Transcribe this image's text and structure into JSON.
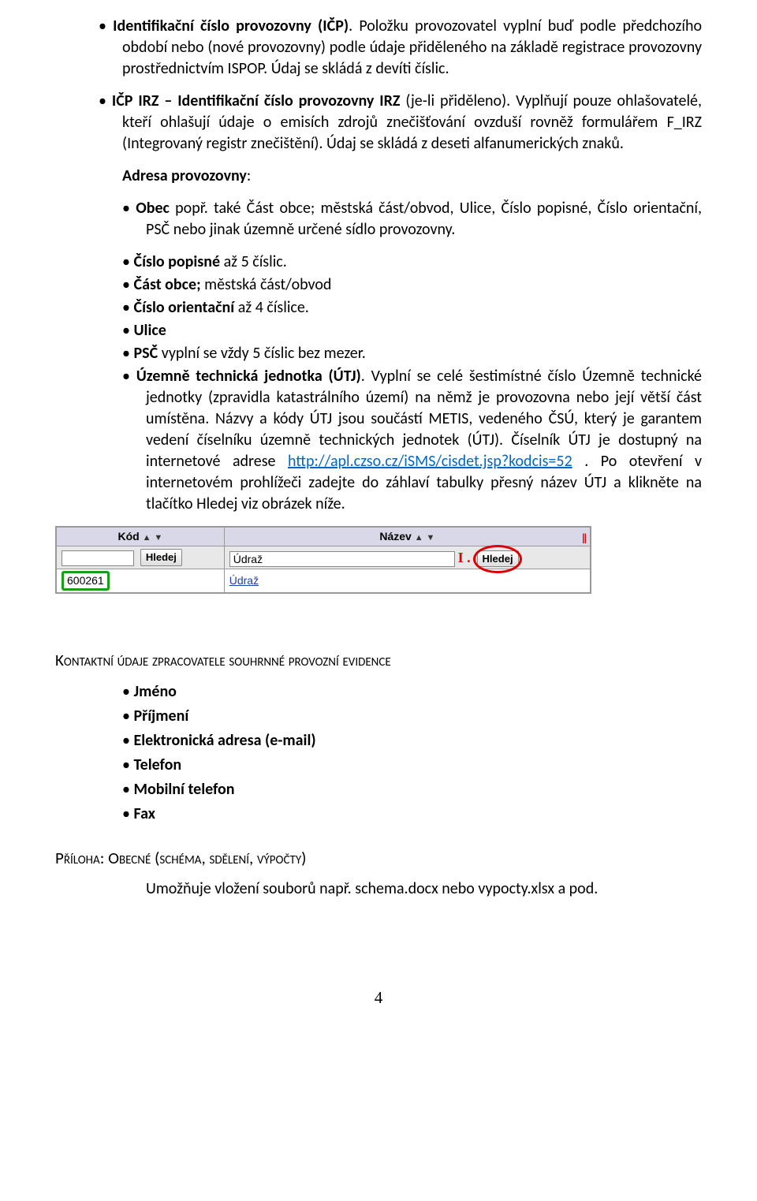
{
  "p1_pre": "",
  "p1_bold": "Identifikační číslo provozovny (IČP)",
  "p1_body": ". Položku provozovatel vyplní buď podle předchozího období nebo (nové provozovny) podle údaje přiděleného na základě registrace provozovny prostřednictvím ISPOP. Údaj se skládá z devíti číslic.",
  "p2_bold": "IČP IRZ – Identifikační číslo provozovny IRZ",
  "p2_paren": " (je-li přiděleno)",
  "p2_body": ". Vyplňují pouze ohlašovatelé, kteří ohlašují údaje o emisích zdrojů znečišťování ovzduší rovněž formulářem F_IRZ (Integrovaný registr znečištění). Údaj se skládá z deseti alfanumerických znaků.",
  "adresa_h": "Adresa provozovny",
  "obec_bold": "Obec",
  "obec_body": " popř. také Část obce; městská část/obvod, Ulice, Číslo popisné, Číslo orientační, PSČ nebo jinak územně určené sídlo provozovny.",
  "cp_bold": "Číslo popisné",
  "cp_body": " až 5 číslic.",
  "cast_bold": "Část obce;",
  "cast_body": " městská část/obvod",
  "co_bold": "Číslo orientační",
  "co_body": " až 4 číslice.",
  "ulice": "Ulice",
  "psc_bold": "PSČ",
  "psc_body": " vyplní se vždy 5 číslic bez mezer.",
  "utj_bold": "Územně technická jednotka (ÚTJ)",
  "utj_body1": ". Vyplní se celé šestimístné číslo Územně technické jednotky (zpravidla katastrálního území) na němž je provozovna nebo její větší část umístěna. Názvy a kódy ÚTJ jsou součástí METIS, vedeného ČSÚ, který je garantem vedení číselníku územně technických jednotek (ÚTJ). Číselník ÚTJ je dostupný na internetové adrese ",
  "utj_link": "http://apl.czso.cz/iSMS/cisdet.jsp?kodcis=52",
  "utj_body2": " . Po otevření v internetovém prohlížeči zadejte do záhlaví tabulky přesný název ÚTJ a klikněte na tlačítko Hledej viz obrázek níže.",
  "table": {
    "col_kod": "Kód",
    "col_nazev": "Název",
    "btn_hledej": "Hledej",
    "input_nazev": "Údraž",
    "result_kod": "600261",
    "result_nazev": "Údraž",
    "red_num": "I ."
  },
  "kontakt_h": "Kontaktní údaje zpracovatele souhrnné provozní evidence",
  "kontakt": {
    "jmeno": "Jméno",
    "prijmeni": "Příjmení",
    "email": "Elektronická adresa (e-mail)",
    "telefon": "Telefon",
    "mobil": "Mobilní telefon",
    "fax": "Fax"
  },
  "priloha_h": "Příloha: Obecné (schéma, sdělení, výpočty)",
  "priloha_body": "Umožňuje vložení souborů např. schema.docx nebo vypocty.xlsx a pod.",
  "pageno": "4"
}
